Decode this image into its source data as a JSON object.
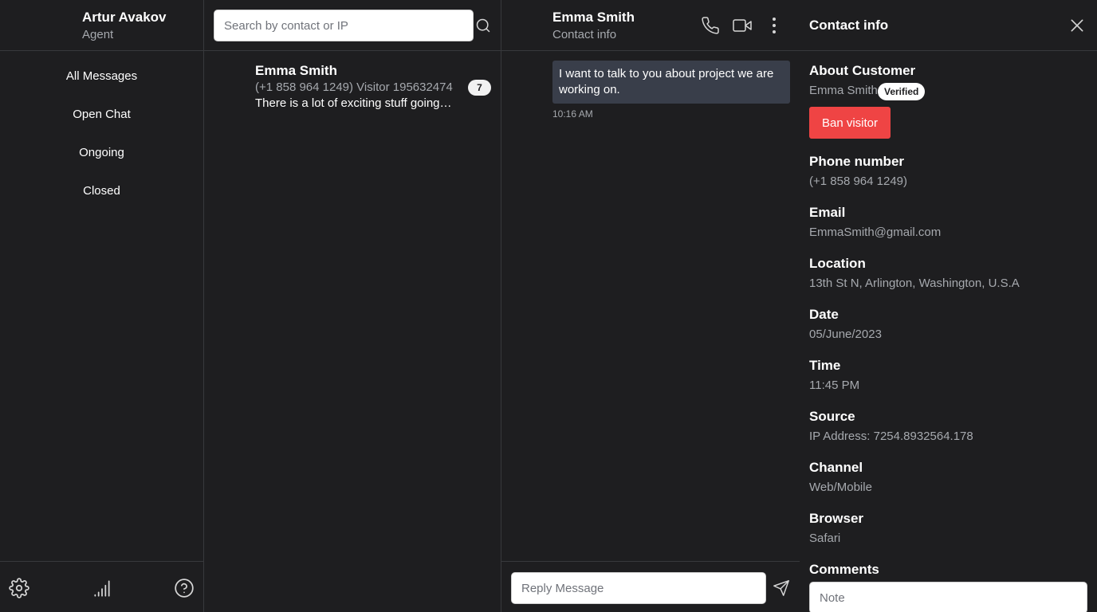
{
  "agent": {
    "name": "Artur Avakov",
    "role": "Agent"
  },
  "nav": {
    "items": [
      {
        "label": "All Messages"
      },
      {
        "label": "Open Chat"
      },
      {
        "label": "Ongoing"
      },
      {
        "label": "Closed"
      }
    ]
  },
  "footer_icons": [
    "gear-icon",
    "signal-bars-icon",
    "help-circle-icon"
  ],
  "search": {
    "placeholder": "Search by contact or IP"
  },
  "conversation": {
    "name": "Emma Smith",
    "meta": "(+1 858 964 1249) Visitor 195632474",
    "preview": "There is a lot of exciting stuff going on in the stars above us that make astronomy so much fun.",
    "unread_count": "7"
  },
  "chat": {
    "header_name": "Emma Smith",
    "header_sub": "Contact info",
    "header_icons": [
      "phone-icon",
      "video-camera-icon",
      "more-vertical-icon"
    ],
    "message": {
      "text": "I want to talk to you about project we are working on.",
      "time": "10:16 AM"
    },
    "reply_placeholder": "Reply Message"
  },
  "contact_info": {
    "title": "Contact info",
    "about_title": "About Customer",
    "customer_name": "Emma Smith",
    "verified_label": "Verified",
    "ban_label": "Ban visitor",
    "fields": [
      {
        "label": "Phone number",
        "value": "(+1 858 964 1249)"
      },
      {
        "label": "Email",
        "value": "EmmaSmith@gmail.com"
      },
      {
        "label": "Location",
        "value": "13th St N, Arlington, Washington, U.S.A"
      },
      {
        "label": "Date",
        "value": "05/June/2023"
      },
      {
        "label": "Time",
        "value": "11:45 PM"
      },
      {
        "label": "Source",
        "value": "IP Address: 7254.8932564.178"
      },
      {
        "label": "Channel",
        "value": "Web/Mobile"
      },
      {
        "label": "Browser",
        "value": "Safari"
      }
    ],
    "comments_title": "Comments",
    "note_placeholder": "Note"
  },
  "colors": {
    "background": "#1e1e20",
    "border": "#38393c",
    "muted_text": "#a6a9ae",
    "message_bubble": "#393e4a",
    "danger": "#ef4444"
  }
}
